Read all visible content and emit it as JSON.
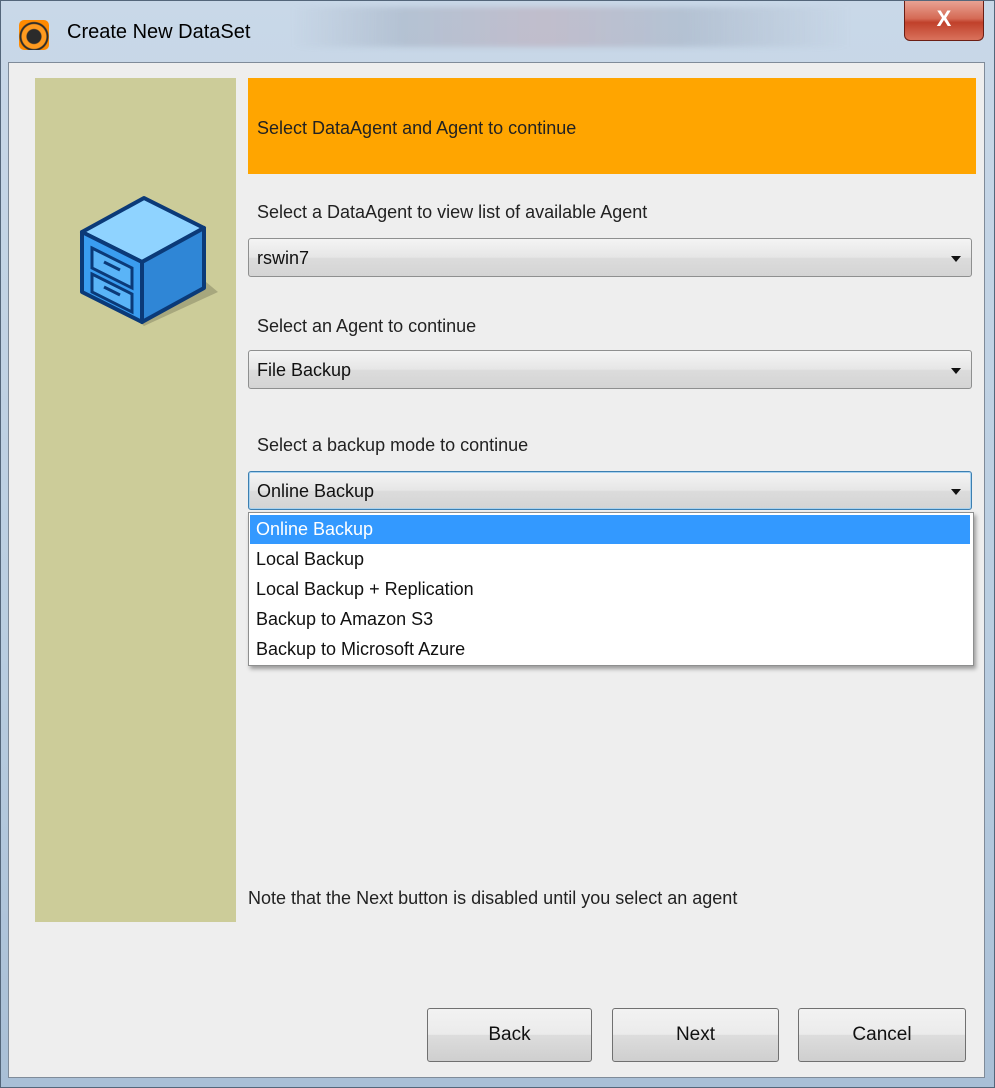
{
  "window": {
    "title": "Create New DataSet",
    "close_glyph": "X"
  },
  "banner": {
    "text": "Select DataAgent and Agent to continue",
    "color": "#ffa500"
  },
  "side_panel": {
    "color": "#cccc99",
    "icon": "file-cabinet-icon"
  },
  "data_agent": {
    "label": "Select a DataAgent to view list of available Agent",
    "value": "rswin7"
  },
  "agent": {
    "label": "Select an Agent to continue",
    "value": "File Backup"
  },
  "backup_mode": {
    "label": "Select a backup mode to continue",
    "value": "Online Backup",
    "options": [
      "Online Backup",
      "Local Backup",
      "Local Backup + Replication",
      "Backup to Amazon S3",
      "Backup to Microsoft Azure"
    ],
    "selected_color": "#3399ff"
  },
  "note": "Note that the Next button is disabled until you select an agent",
  "buttons": {
    "back": "Back",
    "next": "Next",
    "cancel": "Cancel"
  }
}
